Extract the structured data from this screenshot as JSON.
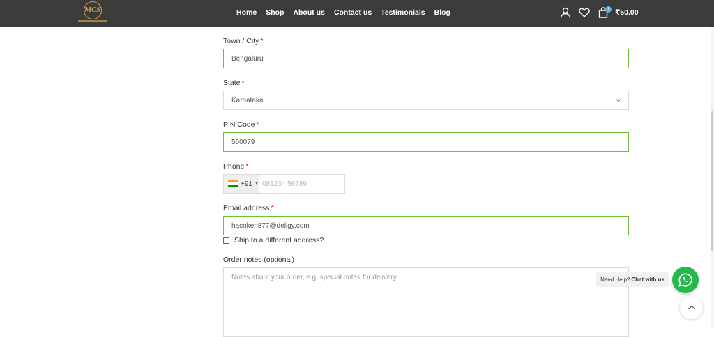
{
  "header": {
    "nav": [
      "Home",
      "Shop",
      "About us",
      "Contact us",
      "Testimonials",
      "Blog"
    ],
    "logo_text": "MCS",
    "cart_count": "1",
    "cart_total": "₹50.00",
    "icons": [
      "user-icon",
      "heart-icon",
      "cart-icon"
    ]
  },
  "form": {
    "city": {
      "label": "Town / City",
      "required": "*",
      "value": "Bengaluru"
    },
    "state": {
      "label": "State",
      "required": "*",
      "value": "Karnataka"
    },
    "pin": {
      "label": "PIN Code",
      "required": "*",
      "value": "560079"
    },
    "phone": {
      "label": "Phone",
      "required": "*",
      "code": "+91",
      "placeholder": "081234 56789"
    },
    "email": {
      "label": "Email address",
      "required": "*",
      "value": "hacokeh877@deligy.com"
    },
    "ship_different": "Ship to a different address?",
    "notes": {
      "label": "Order notes (optional)",
      "placeholder": "Notes about your order, e.g. special notes for delivery."
    }
  },
  "help": {
    "prefix": "Need Help?",
    "link": "Chat with us"
  },
  "colors": {
    "header_bg": "#3b3b3b",
    "valid_border": "#6fbe3a",
    "required": "#e01020",
    "whatsapp": "#25b84b"
  }
}
